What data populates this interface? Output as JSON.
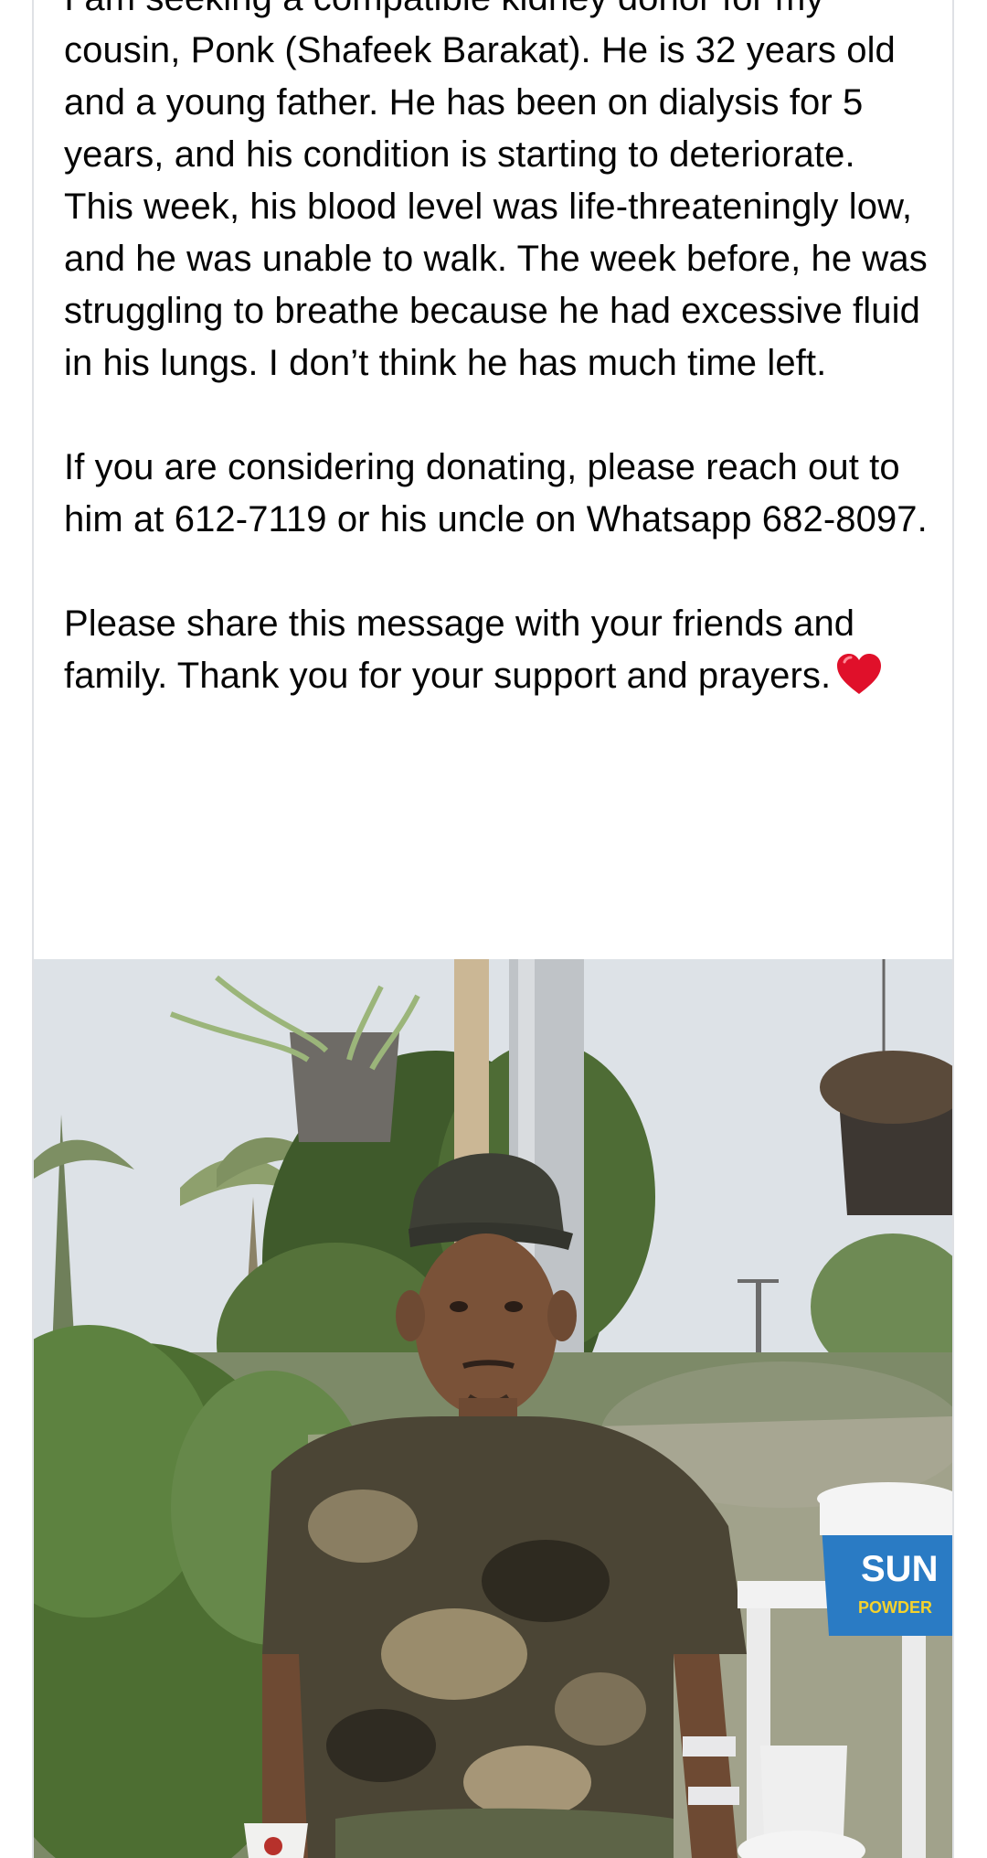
{
  "post": {
    "paragraphs": [
      "I am seeking a compatible kidney donor for my cousin, Ponk (Shafeek Barakat). He is 32 years old and a young father. He has been on dialysis for 5 years, and his condition is starting to deteriorate. This week, his blood level was life-threateningly low, and he was unable to walk. The week before, he was struggling to breathe because he had excessive fluid in his lungs. I don’t think he has much time left.",
      "If you are considering donating, please reach out to him at 612-7119 or his uncle on Whatsapp 682-8097.",
      "Please share this message with your friends and family. Thank you for your support and prayers."
    ],
    "emoji": "heart-icon",
    "photo": {
      "bucket_brand": "SUN",
      "bucket_label": "POWDER"
    }
  },
  "colors": {
    "text": "#050505",
    "heart": "#e0102a",
    "card_border": "#dfe1e5"
  }
}
